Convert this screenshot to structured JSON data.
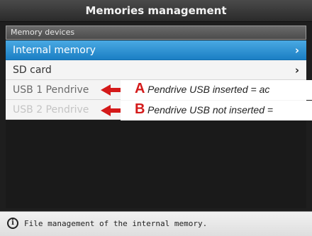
{
  "window": {
    "title": "Memories management"
  },
  "section": {
    "label": "Memory devices"
  },
  "devices": [
    {
      "label": "Internal memory",
      "chevron": "›"
    },
    {
      "label": "SD card",
      "chevron": "›"
    },
    {
      "label": "USB 1 Pendrive"
    },
    {
      "label": "USB 2 Pendrive"
    }
  ],
  "status": {
    "text": "File management of the internal memory."
  },
  "annotations": [
    {
      "letter": "A",
      "text": "Pendrive USB inserted = ac"
    },
    {
      "letter": "B",
      "text": "Pendrive USB not inserted ="
    }
  ],
  "colors": {
    "annotation_red": "#d41a1a",
    "selection_blue": "#1b7fc4"
  }
}
